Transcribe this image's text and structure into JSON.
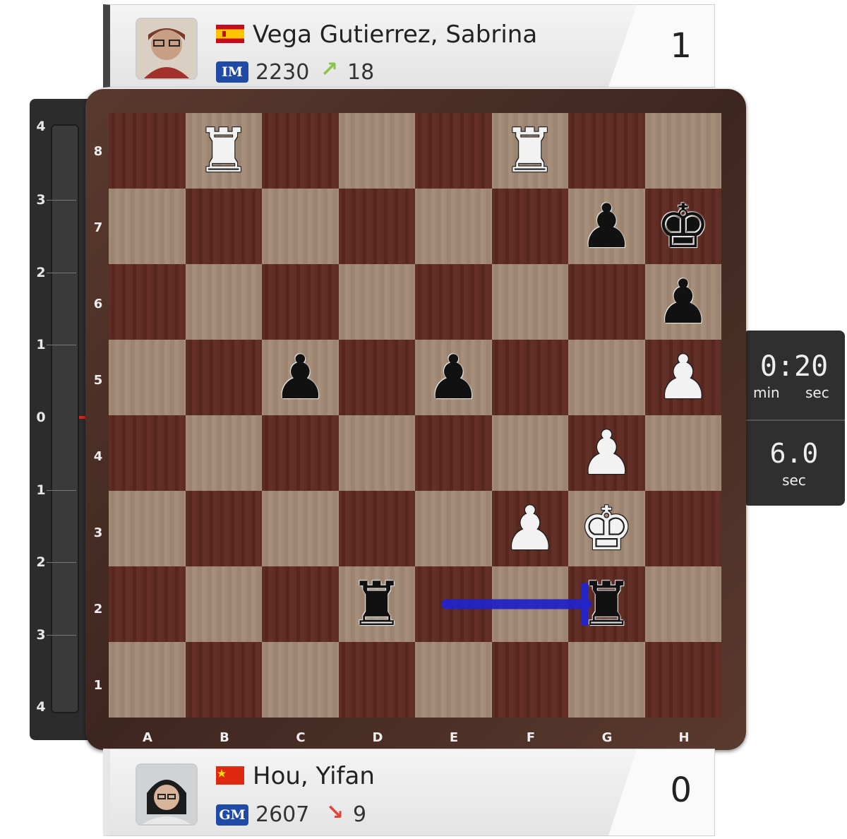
{
  "top_player": {
    "name": "Vega Gutierrez, Sabrina",
    "title": "IM",
    "rating": "2230",
    "rating_change": "18",
    "rating_trend": "up",
    "score": "1",
    "flag": "spain-flag"
  },
  "bottom_player": {
    "name": "Hou, Yifan",
    "title": "GM",
    "rating": "2607",
    "rating_change": "9",
    "rating_trend": "down",
    "score": "0",
    "flag": "china-flag"
  },
  "clock": {
    "time": "0:20",
    "min_label": "min",
    "sec_label": "sec",
    "increment": "6.0",
    "increment_label": "sec"
  },
  "eval_bar": {
    "labels": [
      "4",
      "3",
      "2",
      "1",
      "0",
      "1",
      "2",
      "3",
      "4"
    ],
    "value": 0
  },
  "board": {
    "files": [
      "A",
      "B",
      "C",
      "D",
      "E",
      "F",
      "G",
      "H"
    ],
    "ranks": [
      "8",
      "7",
      "6",
      "5",
      "4",
      "3",
      "2",
      "1"
    ],
    "pieces": {
      "b8": "wR",
      "f8": "wR",
      "g7": "bP",
      "h7": "bK",
      "h6": "bP",
      "c5": "bP",
      "e5": "bP",
      "h5": "wP",
      "g4": "wP",
      "f3": "wP",
      "g3": "wK",
      "d2": "bR",
      "g2": "bR"
    },
    "last_move": {
      "from": "e2",
      "to": "g2"
    }
  },
  "colors": {
    "arrow": "#2323c8",
    "eval_zero": "#dd2222",
    "badge": "#1f4ba5",
    "up": "#8bc34a",
    "down": "#e0443a"
  }
}
